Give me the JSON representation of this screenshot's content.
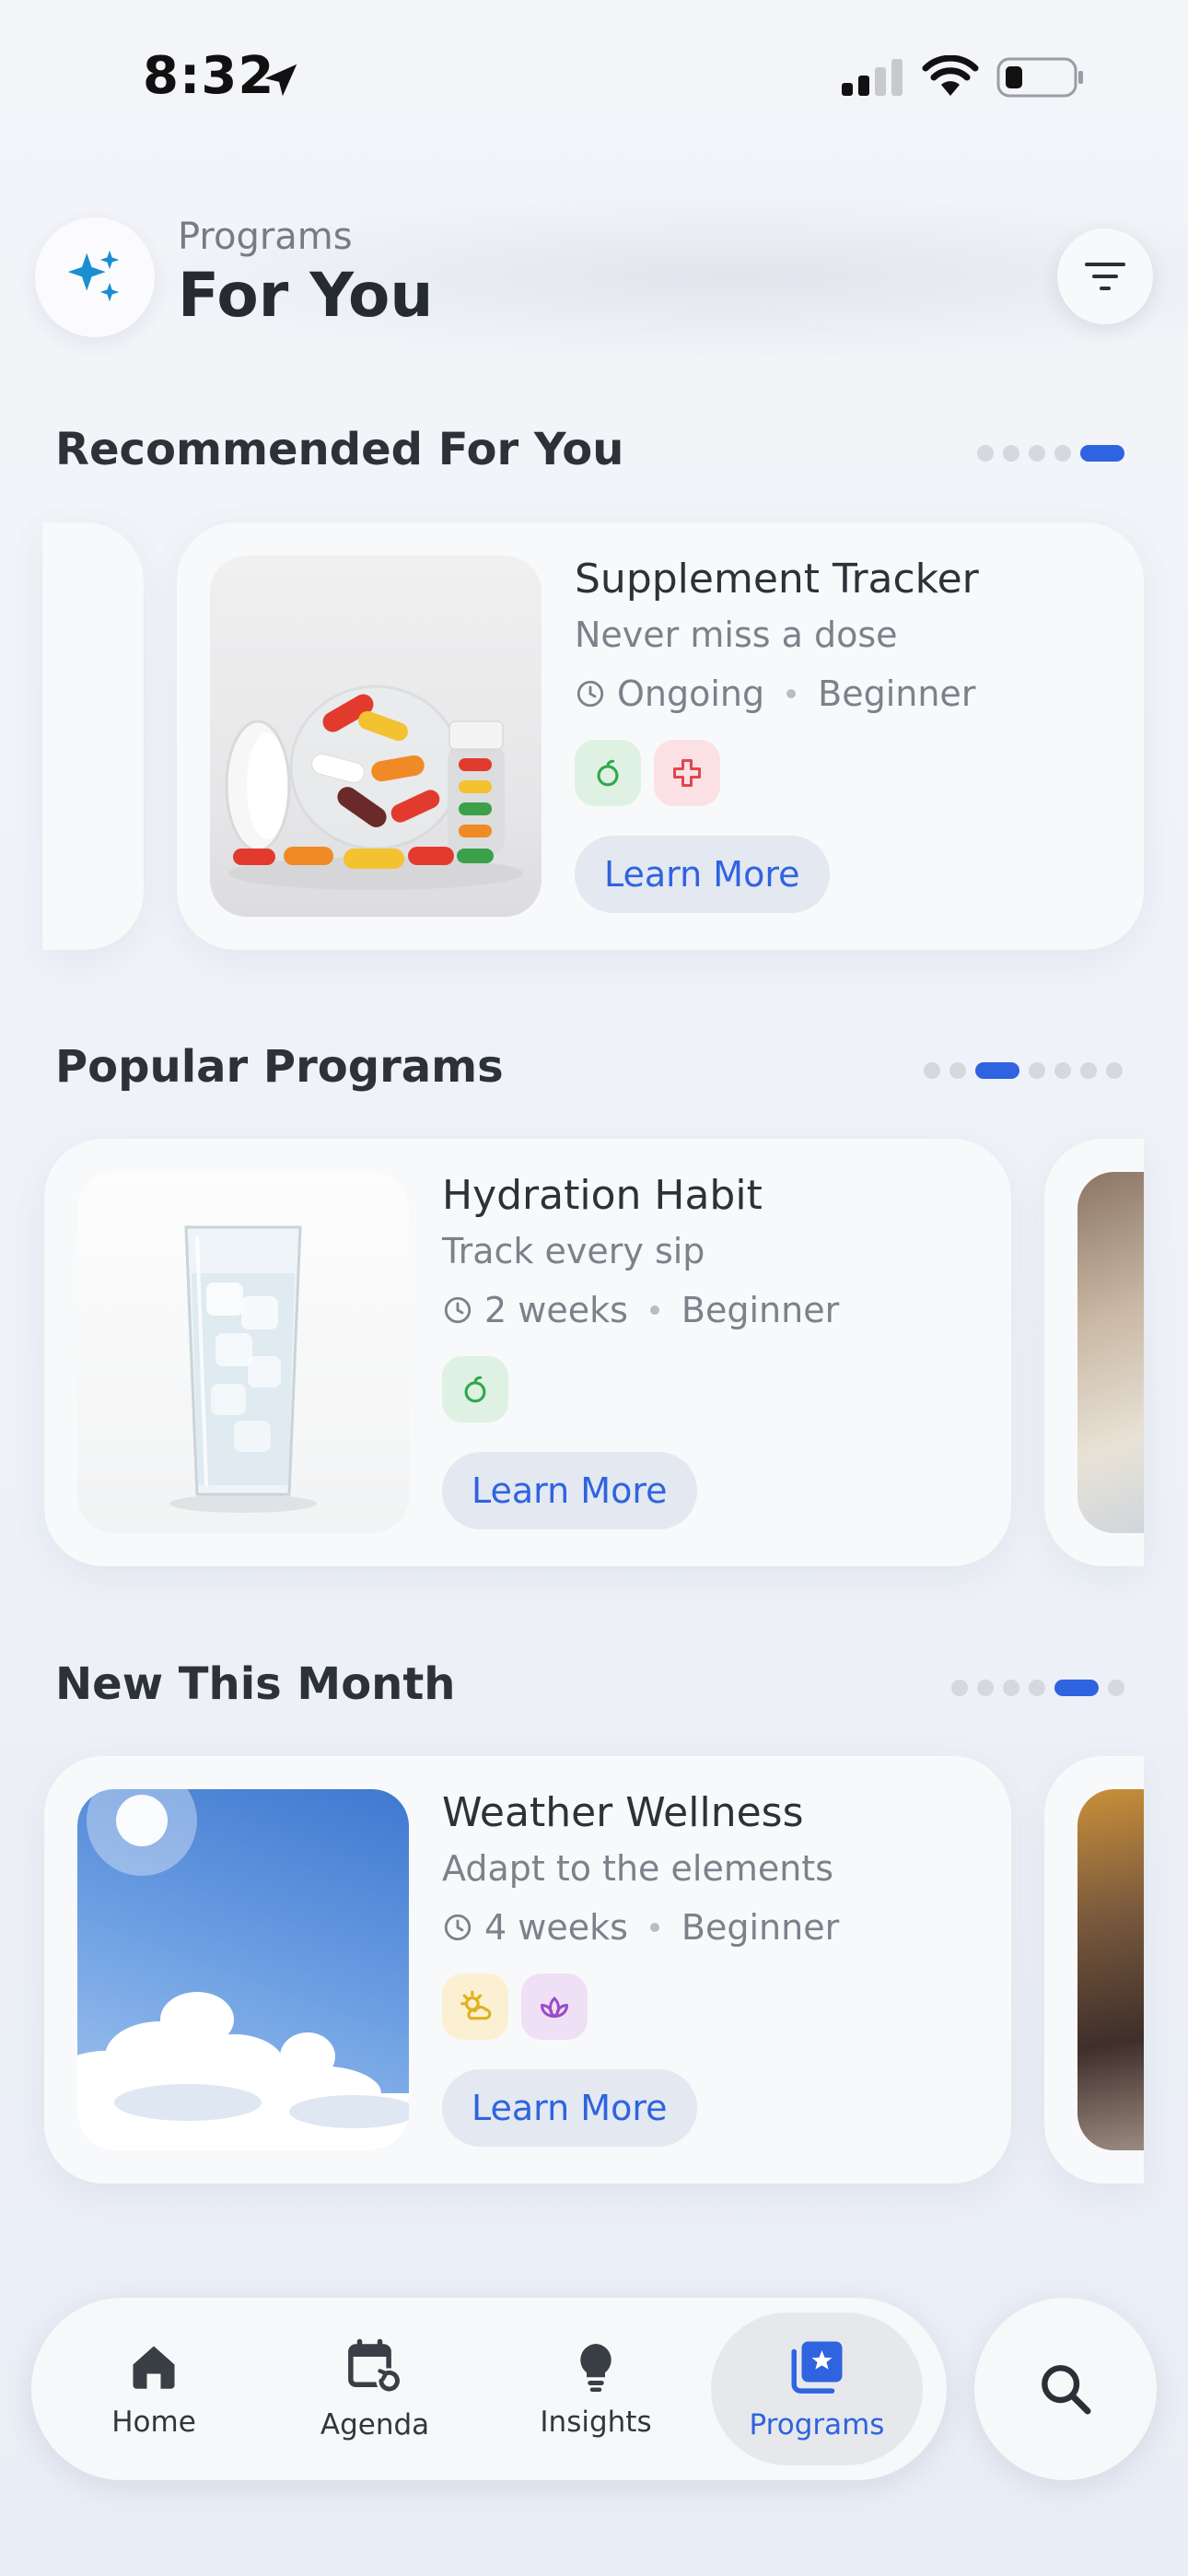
{
  "status_bar": {
    "time": "8:32"
  },
  "header": {
    "subtitle": "Programs",
    "title": "For You"
  },
  "sections": [
    {
      "title": "Recommended For You",
      "card": {
        "title": "Supplement Tracker",
        "subtitle": "Never miss a dose",
        "duration": "Ongoing",
        "level": "Beginner",
        "tags": [
          "nutrition-icon",
          "health-cross-icon"
        ],
        "button": "Learn More"
      }
    },
    {
      "title": "Popular Programs",
      "card": {
        "title": "Hydration Habit",
        "subtitle": "Track every sip",
        "duration": "2 weeks",
        "level": "Beginner",
        "tags": [
          "nutrition-icon"
        ],
        "button": "Learn More"
      }
    },
    {
      "title": "New This Month",
      "card": {
        "title": "Weather Wellness",
        "subtitle": "Adapt to the elements",
        "duration": "4 weeks",
        "level": "Beginner",
        "tags": [
          "sun-cloud-icon",
          "lotus-icon"
        ],
        "button": "Learn More"
      }
    }
  ],
  "nav": {
    "items": [
      {
        "label": "Home",
        "icon": "home-icon"
      },
      {
        "label": "Agenda",
        "icon": "calendar-icon"
      },
      {
        "label": "Insights",
        "icon": "lightbulb-icon"
      },
      {
        "label": "Programs",
        "icon": "programs-icon",
        "active": true
      }
    ],
    "search_icon": "search-icon"
  },
  "colors": {
    "accent": "#2f63e0",
    "nutrition_tag_bg": "#dff1e3",
    "nutrition_tag_fg": "#2fa84f",
    "health_tag_bg": "#fbe1e3",
    "health_tag_fg": "#e0474f",
    "weather_tag_bg": "#fbf1d2",
    "weather_tag_fg": "#e2b01c",
    "mind_tag_bg": "#efe0f6",
    "mind_tag_fg": "#9a4bc7"
  }
}
